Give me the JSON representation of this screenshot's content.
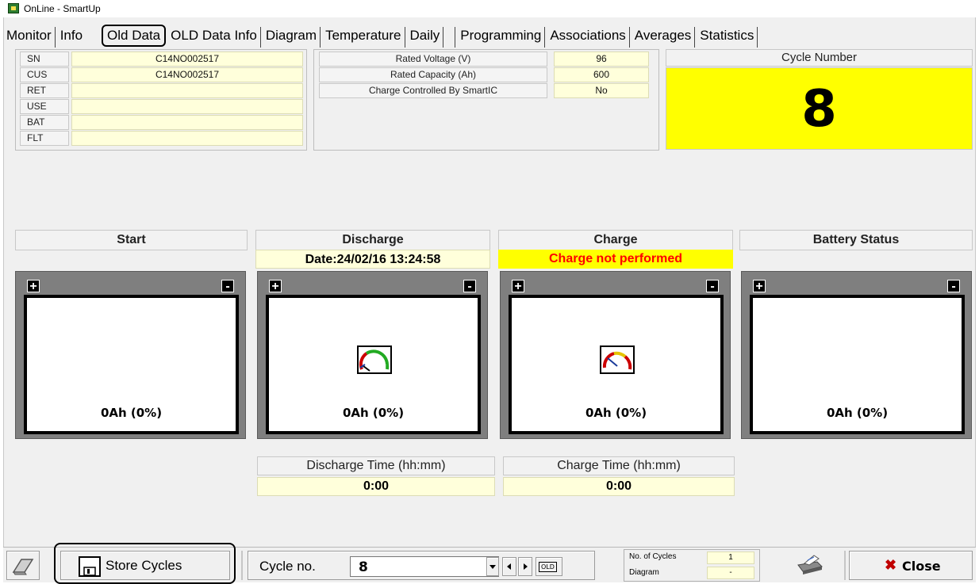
{
  "window": {
    "title": "OnLine - SmartUp"
  },
  "tabs": [
    "Monitor",
    "Info",
    "Old Data",
    "OLD Data Info",
    "Diagram",
    "Temperature",
    "Daily",
    "Programming",
    "Associations",
    "Averages",
    "Statistics"
  ],
  "active_tab": "Old Data",
  "id_fields": [
    {
      "label": "SN",
      "value": "C14NO002517"
    },
    {
      "label": "CUS",
      "value": "C14NO002517"
    },
    {
      "label": "RET",
      "value": ""
    },
    {
      "label": "USE",
      "value": ""
    },
    {
      "label": "BAT",
      "value": ""
    },
    {
      "label": "FLT",
      "value": ""
    }
  ],
  "ratings": [
    {
      "label": "Rated Voltage (V)",
      "value": "96"
    },
    {
      "label": "Rated Capacity (Ah)",
      "value": "600"
    },
    {
      "label": "Charge Controlled By SmartIC",
      "value": "No"
    }
  ],
  "cycle": {
    "label": "Cycle Number",
    "value": "8"
  },
  "sections": {
    "start": {
      "title": "Start"
    },
    "discharge": {
      "title": "Discharge",
      "sub": "Date:24/02/16 13:24:58"
    },
    "charge": {
      "title": "Charge",
      "sub": "Charge not performed"
    },
    "status": {
      "title": "Battery Status"
    }
  },
  "batteries": {
    "start": {
      "plus": "+",
      "minus": "-",
      "amount": "0Ah (0%)"
    },
    "discharge": {
      "plus": "+",
      "minus": "-",
      "amount": "0Ah (0%)"
    },
    "charge": {
      "plus": "+",
      "minus": "-",
      "amount": "0Ah (0%)"
    },
    "status": {
      "plus": "+",
      "minus": "-",
      "amount": "0Ah (0%)"
    }
  },
  "times": {
    "discharge": {
      "label": "Discharge Time (hh:mm)",
      "value": "0:00"
    },
    "charge": {
      "label": "Charge Time (hh:mm)",
      "value": "0:00"
    }
  },
  "toolbar": {
    "store_label": "Store Cycles",
    "cycle_label": "Cycle no.",
    "cycle_value": "8",
    "old_label": "OLD",
    "no_cycles_label": "No. of Cycles",
    "no_cycles_value": "1",
    "diagram_label": "Diagram",
    "diagram_value": "-",
    "close_label": "Close",
    "close_accel": "C"
  },
  "colors": {
    "cycle_bg": "#ffff00",
    "value_bg": "#ffffdb",
    "charge_status_bg": "#ffff00",
    "charge_status_text": "#ff0000",
    "close_icon": "#c00000"
  }
}
